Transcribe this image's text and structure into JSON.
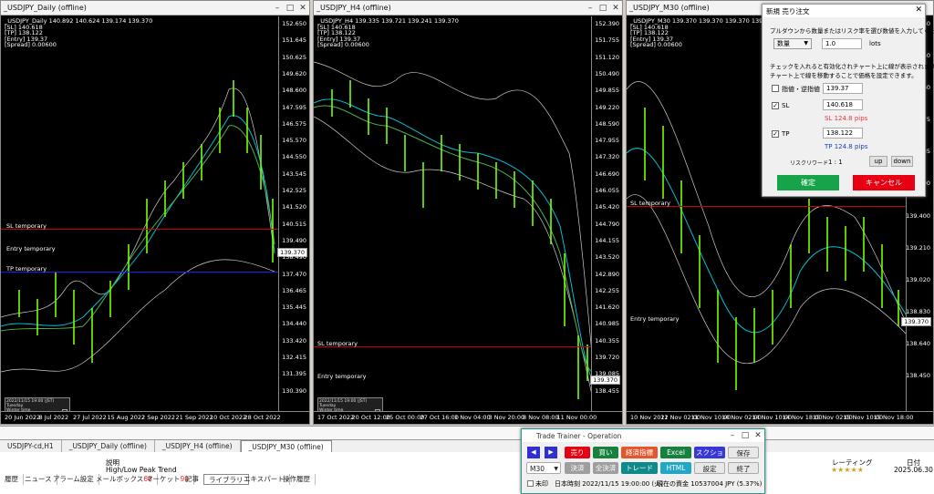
{
  "charts": [
    {
      "title": "_USDJPY_Daily (offline)",
      "ohlc": "_USDJPY_Daily  140.892 140.624 139.174 139.370",
      "lines": [
        "[SL] 140.618",
        "[TP] 138.122",
        "[Entry] 139.37",
        "[Spread] 0.00600"
      ],
      "yticks": [
        "152.650",
        "151.645",
        "150.625",
        "149.620",
        "148.600",
        "147.595",
        "146.575",
        "145.570",
        "144.550",
        "143.545",
        "142.525",
        "141.520",
        "140.515",
        "139.490",
        "138.490",
        "137.470",
        "136.465",
        "135.445",
        "134.440",
        "133.420",
        "132.415",
        "131.395",
        "130.390"
      ],
      "xticks": [
        "20 Jun 2022",
        "8 Jul 2022",
        "27 Jul 2022",
        "15 Aug 2022",
        "2 Sep 2022",
        "21 Sep 2022",
        "10 Oct 2022",
        "28 Oct 2022"
      ],
      "sl_label": "SL temporary",
      "entry_label": "Entry temporary",
      "tp_label": "TP temporary",
      "current": "139.370",
      "info": [
        "2022/11/15 19:00 (JST)",
        "Tuesday",
        "Winter time"
      ]
    },
    {
      "title": "_USDJPY_H4 (offline)",
      "ohlc": "_USDJPY_H4  139.335 139.721 139.241 139.370",
      "lines": [
        "[SL] 140.618",
        "[TP] 138.122",
        "[Entry] 139.37",
        "[Spread] 0.00600"
      ],
      "yticks": [
        "152.390",
        "151.755",
        "151.120",
        "150.490",
        "149.855",
        "149.220",
        "148.590",
        "147.955",
        "147.320",
        "146.690",
        "146.055",
        "145.420",
        "144.790",
        "144.155",
        "143.520",
        "142.890",
        "142.255",
        "141.620",
        "140.985",
        "140.355",
        "139.720",
        "139.085",
        "138.455"
      ],
      "xticks": [
        "17 Oct 2022",
        "20 Oct 12:00",
        "25 Oct 00:00",
        "27 Oct 16:00",
        "1 Nov 04:00",
        "3 Nov 20:00",
        "8 Nov 08:00",
        "11 Nov 00:00"
      ],
      "sl_label": "SL temporary",
      "entry_label": "Entry temporary",
      "current": "139.370",
      "info": [
        "2022/11/15 19:00 (JST)",
        "Tuesday",
        "Winter time"
      ]
    },
    {
      "title": "_USDJPY_M30 (offline)",
      "ohlc": "_USDJPY_M30  139.370 139.370 139.370 139.370",
      "lines": [
        "[SL] 140.618",
        "[TP] 138.122",
        "[Entry] 139.37",
        "[Spread] 0.00600"
      ],
      "yticks": [
        "140.540",
        "140.350",
        "140.160",
        "139.975",
        "139.785",
        "139.590",
        "139.400",
        "139.210",
        "139.020",
        "138.830",
        "138.640",
        "138.450"
      ],
      "xticks": [
        "10 Nov 2022",
        "11 Nov 02:00",
        "11 Nov 10:00",
        "14 Nov 02:00",
        "14 Nov 10:00",
        "14 Nov 18:00",
        "15 Nov 02:00",
        "15 Nov 10:00",
        "15 Nov 18:00"
      ],
      "sl_label": "SL temporary",
      "entry_label": "Entry temporary",
      "current": "139.370"
    }
  ],
  "dialog": {
    "title": "新規 売り注文",
    "desc": "プルダウンから数量またはリスク率を選び数値を入力してください。",
    "qty_option": "数量",
    "qty_value": "1.0",
    "qty_unit": "lots",
    "note1": "チェックを入れると有効化されチャート上に線が表示されます。",
    "note2": "チャート上で線を移動することで価格を設定できます。",
    "limit_label": "指値・逆指値",
    "limit_value": "139.37",
    "sl_label": "SL",
    "sl_value": "140.618",
    "sl_pips": "SL 124.8 pips",
    "tp_label": "TP",
    "tp_value": "138.122",
    "tp_pips": "TP 124.8 pips",
    "rr_label": "リスクリワード",
    "rr_value": "1 : 1",
    "up": "up",
    "down": "down",
    "ok": "確定",
    "cancel": "キャンセル",
    "colors": {
      "ok": "#16a34a",
      "cancel": "#e60012",
      "sl": "#e53935",
      "tp": "#1e40af"
    }
  },
  "tabs": [
    "USDJPY-cd,H1",
    "_USDJPY_Daily (offline)",
    "_USDJPY_H4 (offline)",
    "_USDJPY_M30 (offline)"
  ],
  "terminal": {
    "col_desc": "説明",
    "row_desc": "High/Low Peak Trend",
    "rating_label": "レーティング",
    "rating_stars": 5,
    "date_label": "日付",
    "date_value": "2025.06.30",
    "bottom_tabs": [
      "履歴",
      "ニュース",
      "アラーム設定",
      "メールボックス",
      "マーケット",
      "記事",
      "ライブラリ",
      "エキスパート",
      "操作履歴"
    ],
    "mail_count": "68",
    "market_count": "90"
  },
  "trainer": {
    "title": "Trade Trainer - Operation",
    "buttons_row1": [
      "売り",
      "買い",
      "経済指標",
      "Excel",
      "スクショ",
      "保存"
    ],
    "buttons_row2": [
      "決済",
      "全決済",
      "トレード",
      "HTML",
      "設定",
      "終了"
    ],
    "timeframe": "M30",
    "unmark": "未印",
    "time_text": "日本時刻 2022/11/15 19:00:00 (火)",
    "capital_text": "現在の資金 10537004 JPY (5.37%)"
  }
}
